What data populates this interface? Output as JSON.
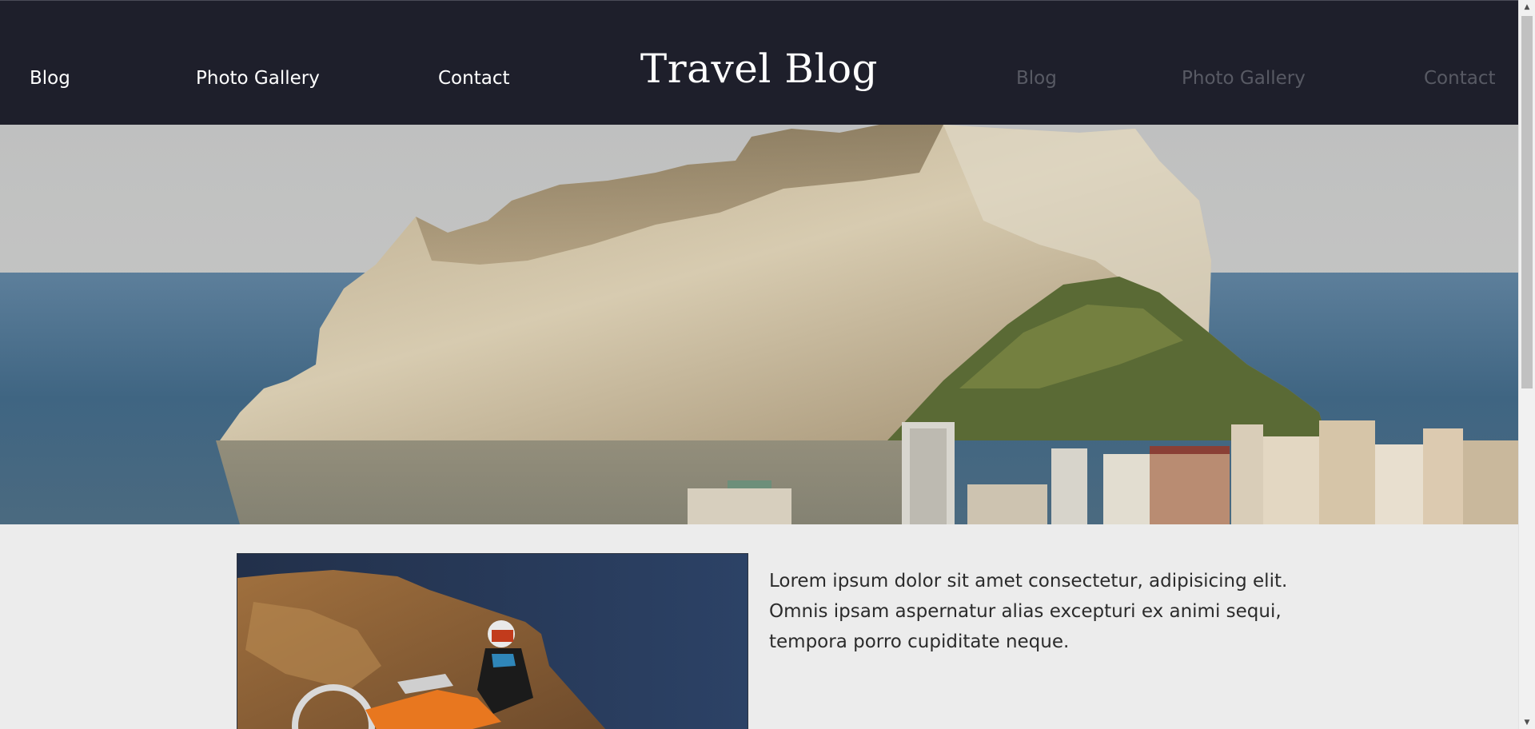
{
  "header": {
    "title": "Travel Blog",
    "nav_left": [
      {
        "label": "Blog"
      },
      {
        "label": "Photo Gallery"
      },
      {
        "label": "Contact"
      }
    ],
    "nav_right": [
      {
        "label": "Blog"
      },
      {
        "label": "Photo Gallery"
      },
      {
        "label": "Contact"
      }
    ],
    "colors": {
      "background": "#1e1f2b",
      "nav_left": "#ffffff",
      "nav_right": "#585a64"
    }
  },
  "hero": {
    "image": "coastal-rock-cliff-city-photo"
  },
  "post": {
    "image": "motocross-rider-desert-cliff-photo",
    "text": "Lorem ipsum dolor sit amet consectetur, adipisicing elit. Omnis ipsam aspernatur alias excepturi ex animi sequi, tempora porro cupiditate neque."
  },
  "scrollbar": {
    "up_icon": "arrow-up-icon",
    "down_icon": "arrow-down-icon"
  }
}
